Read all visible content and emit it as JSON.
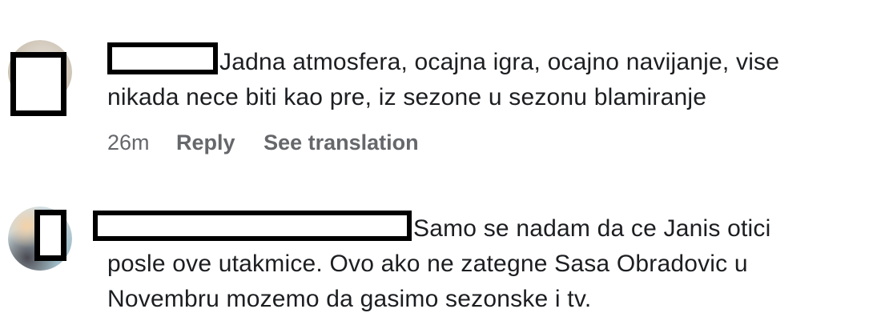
{
  "comments": [
    {
      "text_line1": "Jadna atmosfera, ocajna igra, ocajno navijanje, vise",
      "text_line2": "nikada nece biti kao pre, iz sezone u sezonu blamiranje",
      "age": "26m",
      "reply_label": "Reply",
      "translate_label": "See translation"
    },
    {
      "text_line1": "Samo se nadam da ce Janis otici",
      "text_line2": "posle ove utakmice. Ovo ako ne zategne Sasa Obradovic u",
      "text_line3": "Novembru mozemo da gasimo sezonske i tv."
    }
  ]
}
